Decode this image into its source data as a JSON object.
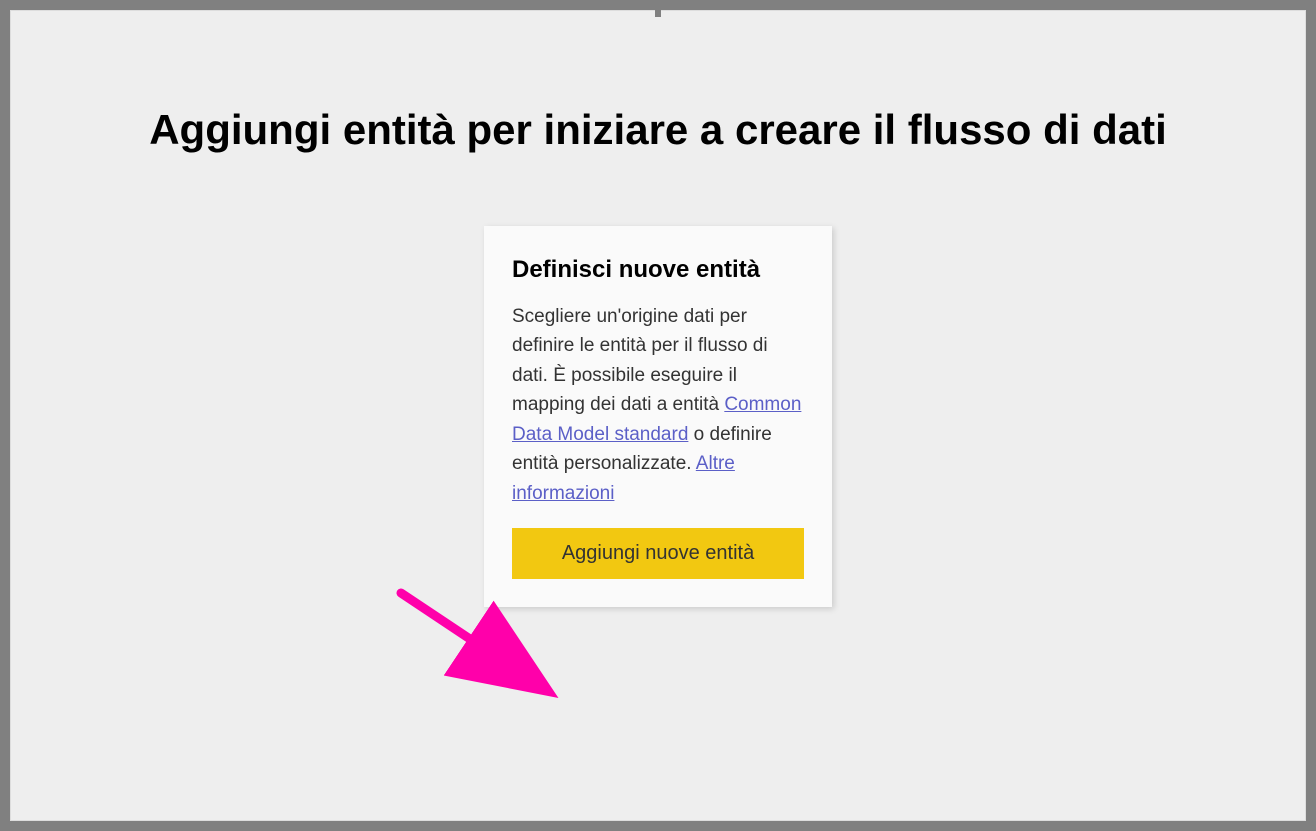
{
  "page": {
    "title": "Aggiungi entità per iniziare a creare il flusso di dati"
  },
  "card": {
    "title": "Definisci nuove entità",
    "body_part1": "Scegliere un'origine dati per definire le entità per il flusso di dati. È possibile eseguire il mapping dei dati a entità ",
    "link1": "Common Data Model standard",
    "body_part2": " o definire entità personalizzate. ",
    "link2": "Altre informazioni",
    "button_label": "Aggiungi nuove entità"
  },
  "colors": {
    "accent": "#f2c811",
    "link": "#5b5fc7",
    "annotation": "#ff00aa"
  }
}
